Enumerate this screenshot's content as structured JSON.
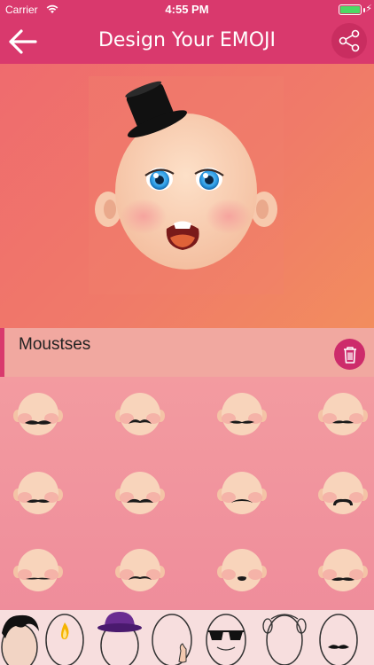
{
  "status_bar": {
    "carrier": "Carrier",
    "time": "4:55 PM"
  },
  "header": {
    "title": "Design Your EMOJI"
  },
  "category": {
    "label": "Moustses"
  },
  "colors": {
    "header": "#d9396d",
    "accent": "#d9396d",
    "delete_button": "#cd2b6b"
  },
  "icons": {
    "back": "arrow-left-icon",
    "share": "share-icon",
    "delete": "trash-icon"
  },
  "moustache_grid": {
    "columns": 4,
    "rows": 3,
    "items": [
      "moustache-1",
      "moustache-2",
      "moustache-3",
      "moustache-4",
      "moustache-5",
      "moustache-6",
      "moustache-7",
      "moustache-8",
      "moustache-9",
      "moustache-10",
      "moustache-11",
      "moustache-12"
    ]
  },
  "tabs": [
    "hair-tab",
    "face-color-tab",
    "hats-tab",
    "hands-tab",
    "glasses-tab",
    "ears-tab",
    "moustaches-tab"
  ]
}
